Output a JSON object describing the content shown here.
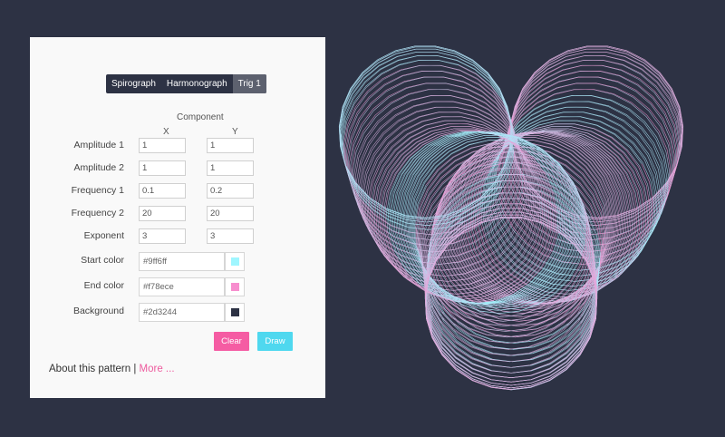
{
  "tabs": [
    {
      "label": "Spirograph",
      "active": false
    },
    {
      "label": "Harmonograph",
      "active": false
    },
    {
      "label": "Trig 1",
      "active": true
    }
  ],
  "form": {
    "component_header": "Component",
    "x_header": "X",
    "y_header": "Y",
    "rows": [
      {
        "label": "Amplitude 1",
        "x": "1",
        "y": "1"
      },
      {
        "label": "Amplitude 2",
        "x": "1",
        "y": "1"
      },
      {
        "label": "Frequency 1",
        "x": "0.1",
        "y": "0.2"
      },
      {
        "label": "Frequency 2",
        "x": "20",
        "y": "20"
      },
      {
        "label": "Exponent",
        "x": "3",
        "y": "3"
      }
    ],
    "colors": [
      {
        "label": "Start color",
        "value": "#9ff6ff",
        "swatch": "#9ff6ff"
      },
      {
        "label": "End color",
        "value": "#f78ece",
        "swatch": "#f78ece"
      },
      {
        "label": "Background",
        "value": "#2d3244",
        "swatch": "#2d3244"
      }
    ]
  },
  "buttons": {
    "clear": {
      "label": "Clear",
      "color": "#f55ca3"
    },
    "draw": {
      "label": "Draw",
      "color": "#4fd8ef"
    }
  },
  "footer": {
    "about_text": "About this pattern |",
    "more_link": "More ..."
  },
  "canvas": {
    "background": "#2d3244",
    "start_color": "#9ff6ff",
    "end_color": "#f78ece"
  }
}
